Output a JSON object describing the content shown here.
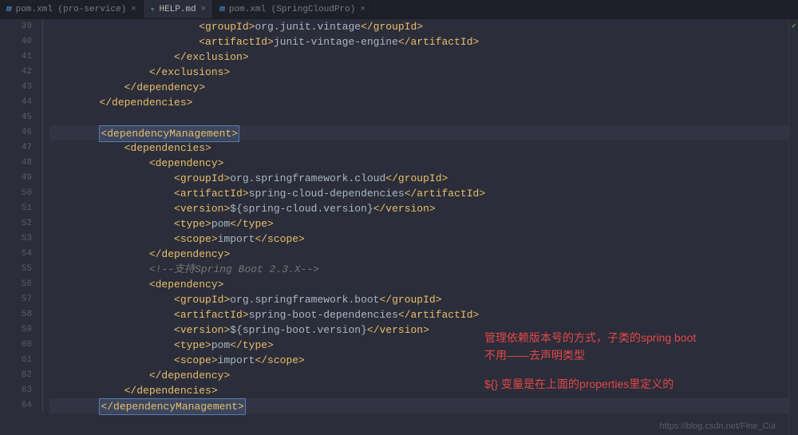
{
  "tabs": [
    {
      "icon": "m",
      "label": "pom.xml (pro-service)",
      "active": false
    },
    {
      "icon": "md",
      "label": "HELP.md",
      "active": true
    },
    {
      "icon": "m",
      "label": "pom.xml (SpringCloudPro)",
      "active": false
    }
  ],
  "line_start": 39,
  "line_end": 64,
  "highlighted_lines": [
    46,
    64
  ],
  "bulb_line": 46,
  "lines": [
    {
      "indent": 24,
      "parts": [
        {
          "t": "tag",
          "v": "<groupId>"
        },
        {
          "t": "text",
          "v": "org.junit.vintage"
        },
        {
          "t": "tag",
          "v": "</groupId>"
        }
      ]
    },
    {
      "indent": 24,
      "parts": [
        {
          "t": "tag",
          "v": "<artifactId>"
        },
        {
          "t": "text",
          "v": "junit-vintage-engine"
        },
        {
          "t": "tag",
          "v": "</artifactId>"
        }
      ]
    },
    {
      "indent": 20,
      "parts": [
        {
          "t": "tag",
          "v": "</exclusion>"
        }
      ]
    },
    {
      "indent": 16,
      "parts": [
        {
          "t": "tag",
          "v": "</exclusions>"
        }
      ]
    },
    {
      "indent": 12,
      "parts": [
        {
          "t": "tag",
          "v": "</dependency>"
        }
      ]
    },
    {
      "indent": 8,
      "parts": [
        {
          "t": "tag",
          "v": "</dependencies>"
        }
      ]
    },
    {
      "indent": 0,
      "parts": []
    },
    {
      "indent": 8,
      "box": true,
      "parts": [
        {
          "t": "tag",
          "v": "<dependencyManagement>"
        }
      ]
    },
    {
      "indent": 12,
      "parts": [
        {
          "t": "tag",
          "v": "<dependencies>"
        }
      ]
    },
    {
      "indent": 16,
      "parts": [
        {
          "t": "tag",
          "v": "<dependency>"
        }
      ]
    },
    {
      "indent": 20,
      "parts": [
        {
          "t": "tag",
          "v": "<groupId>"
        },
        {
          "t": "text",
          "v": "org.springframework.cloud"
        },
        {
          "t": "tag",
          "v": "</groupId>"
        }
      ]
    },
    {
      "indent": 20,
      "parts": [
        {
          "t": "tag",
          "v": "<artifactId>"
        },
        {
          "t": "text",
          "v": "spring-cloud-dependencies"
        },
        {
          "t": "tag",
          "v": "</artifactId>"
        }
      ]
    },
    {
      "indent": 20,
      "parts": [
        {
          "t": "tag",
          "v": "<version>"
        },
        {
          "t": "text",
          "v": "${spring-cloud.version}"
        },
        {
          "t": "tag",
          "v": "</version>"
        }
      ]
    },
    {
      "indent": 20,
      "parts": [
        {
          "t": "tag",
          "v": "<type>"
        },
        {
          "t": "text",
          "v": "pom"
        },
        {
          "t": "tag",
          "v": "</type>"
        }
      ]
    },
    {
      "indent": 20,
      "parts": [
        {
          "t": "tag",
          "v": "<scope>"
        },
        {
          "t": "text",
          "v": "import"
        },
        {
          "t": "tag",
          "v": "</scope>"
        }
      ]
    },
    {
      "indent": 16,
      "parts": [
        {
          "t": "tag",
          "v": "</dependency>"
        }
      ]
    },
    {
      "indent": 16,
      "parts": [
        {
          "t": "comment",
          "v": "<!--支持Spring Boot 2.3.X-->"
        }
      ]
    },
    {
      "indent": 16,
      "parts": [
        {
          "t": "tag",
          "v": "<dependency>"
        }
      ]
    },
    {
      "indent": 20,
      "parts": [
        {
          "t": "tag",
          "v": "<groupId>"
        },
        {
          "t": "text",
          "v": "org.springframework.boot"
        },
        {
          "t": "tag",
          "v": "</groupId>"
        }
      ]
    },
    {
      "indent": 20,
      "parts": [
        {
          "t": "tag",
          "v": "<artifactId>"
        },
        {
          "t": "text",
          "v": "spring-boot-dependencies"
        },
        {
          "t": "tag",
          "v": "</artifactId>"
        }
      ]
    },
    {
      "indent": 20,
      "parts": [
        {
          "t": "tag",
          "v": "<version>"
        },
        {
          "t": "text",
          "v": "${spring-boot.version}"
        },
        {
          "t": "tag",
          "v": "</version>"
        }
      ]
    },
    {
      "indent": 20,
      "parts": [
        {
          "t": "tag",
          "v": "<type>"
        },
        {
          "t": "text",
          "v": "pom"
        },
        {
          "t": "tag",
          "v": "</type>"
        }
      ]
    },
    {
      "indent": 20,
      "parts": [
        {
          "t": "tag",
          "v": "<scope>"
        },
        {
          "t": "text",
          "v": "import"
        },
        {
          "t": "tag",
          "v": "</scope>"
        }
      ]
    },
    {
      "indent": 16,
      "parts": [
        {
          "t": "tag",
          "v": "</dependency>"
        }
      ]
    },
    {
      "indent": 12,
      "parts": [
        {
          "t": "tag",
          "v": "</dependencies>"
        }
      ]
    },
    {
      "indent": 8,
      "box": true,
      "parts": [
        {
          "t": "tag",
          "v": "</dependencyManagement>"
        }
      ]
    }
  ],
  "annotation": {
    "line1": "管理依赖版本号的方式，子类的spring boot",
    "line2": "不用——去声明类型",
    "line3": "${} 变量是在上面的properties里定义的"
  },
  "watermark": "https://blog.csdn.net/Fine_Cui"
}
